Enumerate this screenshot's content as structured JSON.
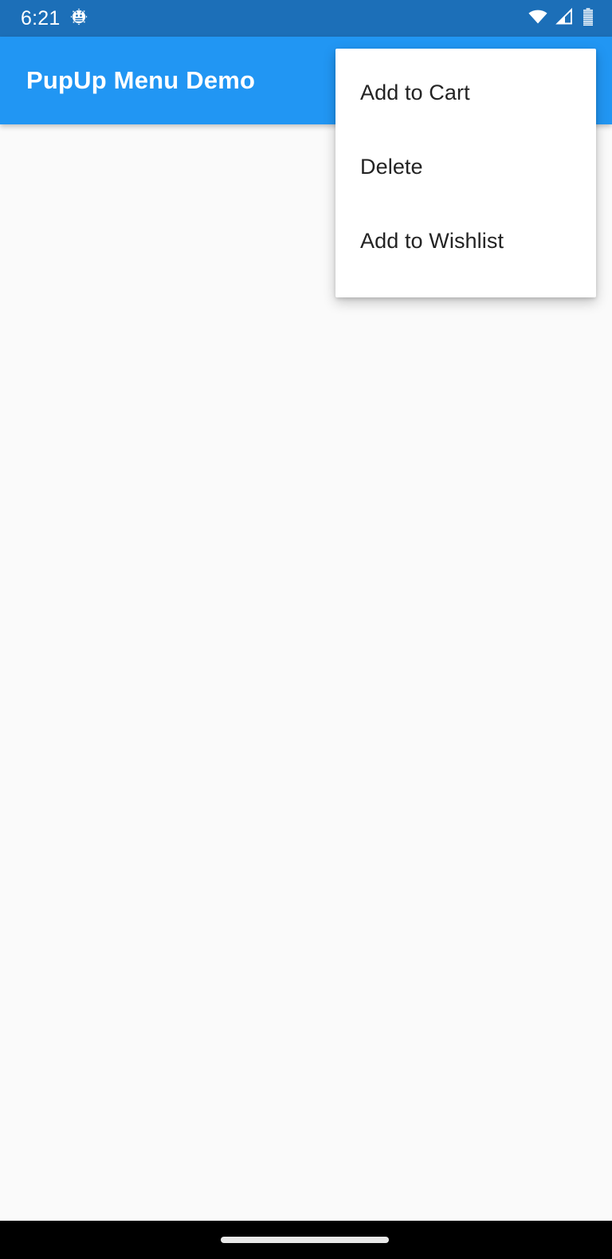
{
  "status_bar": {
    "background_color": "#1c6fb8",
    "time": "6:21",
    "icons": {
      "debug": "android-bug-gear-icon",
      "wifi": "wifi-icon",
      "cellular": "cellular-signal-icon",
      "battery": "battery-icon"
    }
  },
  "app_bar": {
    "background_color": "#2196f3",
    "title": "PupUp Menu Demo",
    "title_color": "#ffffff"
  },
  "content": {
    "background_color": "#fafafa"
  },
  "popup_menu": {
    "visible": true,
    "background_color": "#ffffff",
    "text_color": "#232323",
    "items": [
      {
        "label": "Add to Cart"
      },
      {
        "label": "Delete"
      },
      {
        "label": "Add to Wishlist"
      }
    ]
  },
  "nav_bar": {
    "background_color": "#000000",
    "gesture_pill_color": "#e8e8e8"
  }
}
